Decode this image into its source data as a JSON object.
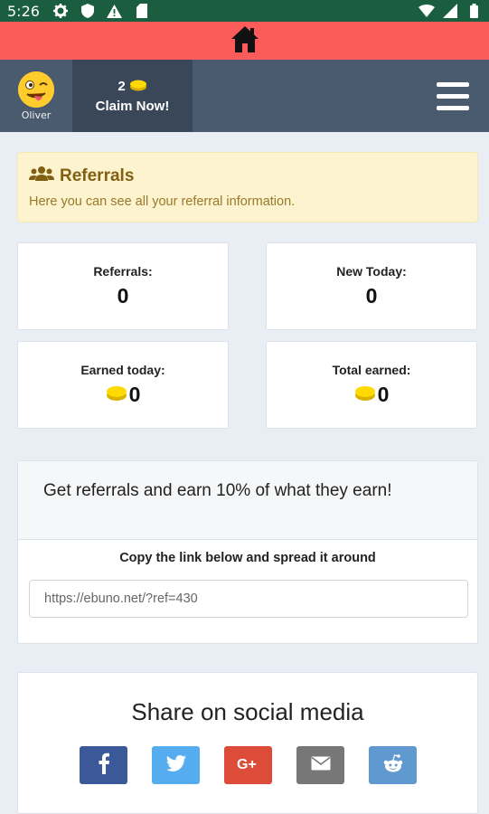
{
  "status_bar": {
    "time": "5:26",
    "left_icons": [
      "gear-icon",
      "shield-icon",
      "warning-icon",
      "sd-card-icon"
    ],
    "right_icons": [
      "wifi-icon",
      "signal-icon",
      "battery-icon"
    ]
  },
  "home_bar": {
    "icon": "home-icon",
    "color": "#fc5b5b"
  },
  "nav": {
    "avatar_name": "Oliver",
    "claim_count": "2",
    "claim_label": "Claim Now!",
    "menu_icon": "hamburger-menu-icon"
  },
  "referrals_header": {
    "title": "Referrals",
    "subtitle": "Here you can see all your referral information."
  },
  "stats": [
    {
      "label": "Referrals:",
      "value": "0",
      "coin": false
    },
    {
      "label": "New Today:",
      "value": "0",
      "coin": false
    },
    {
      "label": "Earned today:",
      "value": "0",
      "coin": true
    },
    {
      "label": "Total earned:",
      "value": "0",
      "coin": true
    }
  ],
  "earn_panel": {
    "heading": "Get referrals and earn 10% of what they earn!",
    "copy_label": "Copy the link below and spread it around",
    "link_value": "https://ebuno.net/?ref=430"
  },
  "share": {
    "title": "Share on social media",
    "buttons": [
      {
        "name": "facebook",
        "icon": "facebook-icon",
        "color": "#3b5998"
      },
      {
        "name": "twitter",
        "icon": "twitter-icon",
        "color": "#55acee"
      },
      {
        "name": "google-plus",
        "icon": "google-plus-icon",
        "color": "#dd4b39"
      },
      {
        "name": "email",
        "icon": "email-icon",
        "color": "#777777"
      },
      {
        "name": "reddit",
        "icon": "reddit-icon",
        "color": "#5f99cf"
      }
    ]
  },
  "colors": {
    "nav_bg": "#4a5a6f",
    "claim_bg": "#3a4759",
    "alert_bg": "#fdf3ce",
    "alert_text": "#816014",
    "page_bg": "#e9eef5",
    "status_bar": "#1b5e3f"
  }
}
